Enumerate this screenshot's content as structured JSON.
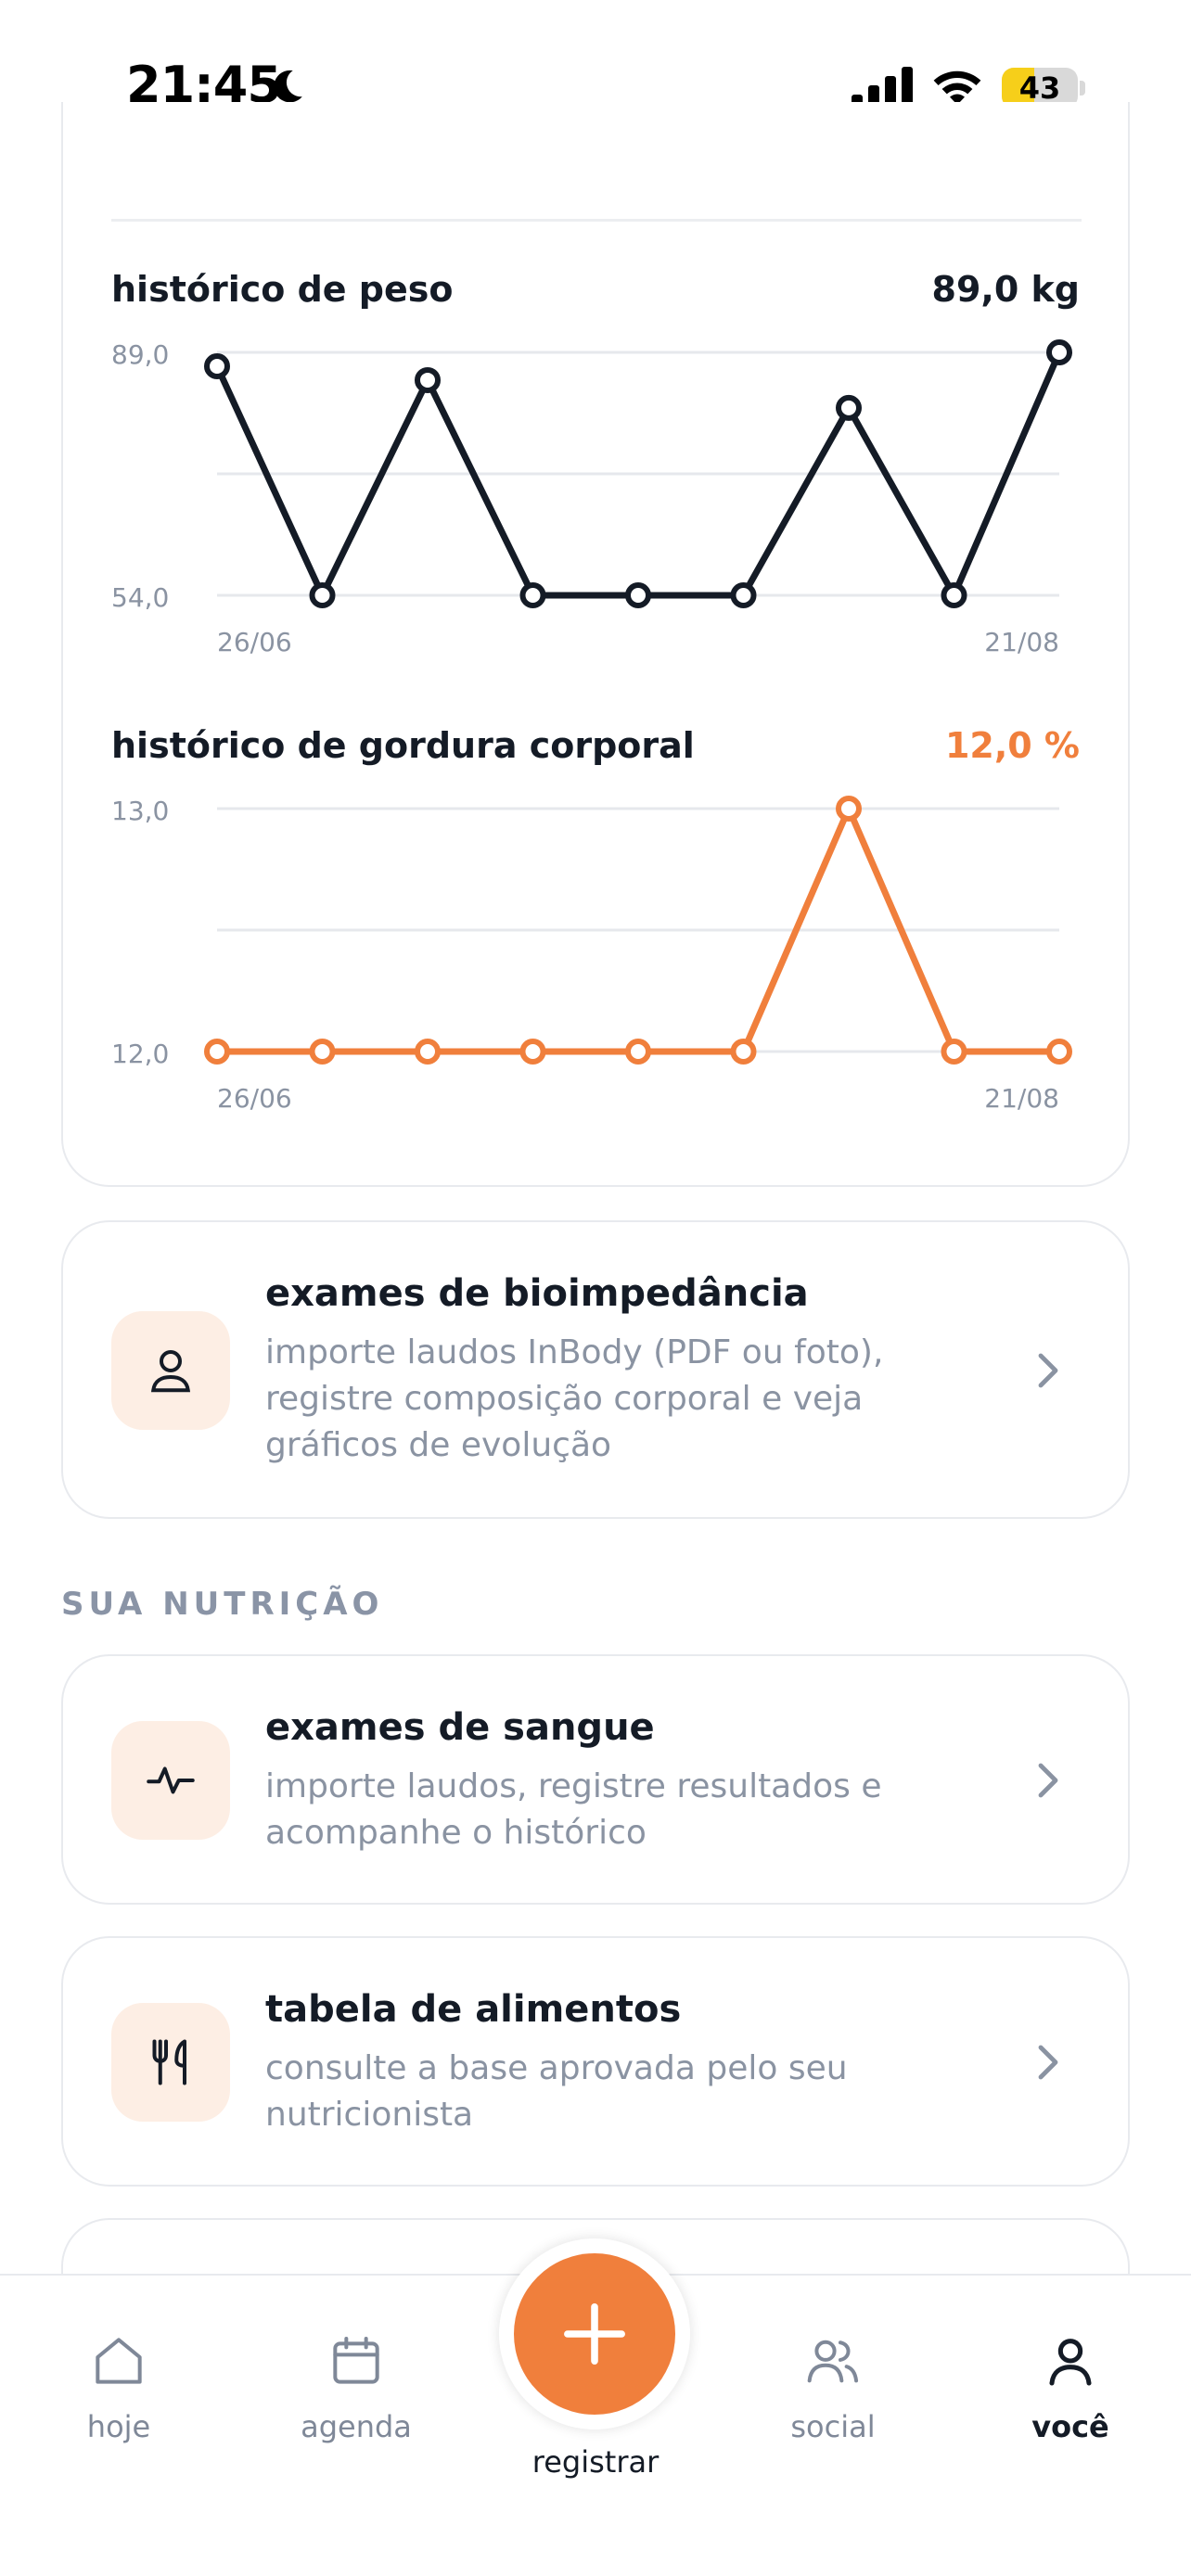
{
  "status_bar": {
    "time": "21:45",
    "battery": "43",
    "battery_level": 0.43,
    "icons": [
      "moon-icon",
      "signal-icon",
      "wifi-icon",
      "battery-icon"
    ]
  },
  "weight_chart": {
    "title": "histórico de peso",
    "current_value": "89,0 kg",
    "y_max_label": "89,0",
    "y_min_label": "54,0",
    "x_start_label": "26/06",
    "x_end_label": "21/08",
    "color": "#141b26"
  },
  "fat_chart": {
    "title": "histórico de gordura corporal",
    "current_value": "12,0 %",
    "y_max_label": "13,0",
    "y_min_label": "12,0",
    "x_start_label": "26/06",
    "x_end_label": "21/08",
    "color": "#f07f3c"
  },
  "chart_data": [
    {
      "type": "line",
      "title": "histórico de peso",
      "x": [
        "26/06",
        "",
        "",
        "",
        "",
        "",
        "",
        "",
        "21/08"
      ],
      "series": [
        {
          "values": [
            87.0,
            54.0,
            85.0,
            54.0,
            54.0,
            54.0,
            81.0,
            54.0,
            89.0
          ]
        }
      ],
      "ylim": [
        54.0,
        89.0
      ],
      "yticks": [
        "54,0",
        "89,0"
      ],
      "grid": true,
      "color": "#141b26"
    },
    {
      "type": "line",
      "title": "histórico de gordura corporal",
      "x": [
        "26/06",
        "",
        "",
        "",
        "",
        "",
        "",
        "",
        "21/08"
      ],
      "series": [
        {
          "values": [
            12.0,
            12.0,
            12.0,
            12.0,
            12.0,
            12.0,
            13.0,
            12.0,
            12.0
          ]
        }
      ],
      "ylim": [
        12.0,
        13.0
      ],
      "yticks": [
        "12,0",
        "13,0"
      ],
      "grid": true,
      "color": "#f07f3c"
    }
  ],
  "bioimpedance": {
    "title": "exames de bioimpedância",
    "description": "importe laudos InBody (PDF ou foto), registre composição corporal e veja gráficos de evolução",
    "icon": "person-icon"
  },
  "nutrition_section": {
    "label": "SUA NUTRIÇÃO"
  },
  "blood_exams": {
    "title": "exames de sangue",
    "description": "importe laudos, registre resultados e acompanhe o histórico",
    "icon": "pulse-icon"
  },
  "food_table": {
    "title": "tabela de alimentos",
    "description": "consulte a base aprovada pelo seu nutricionista",
    "icon": "utensils-icon"
  },
  "bottom_nav": {
    "items": [
      {
        "label": "hoje",
        "icon": "home-icon"
      },
      {
        "label": "agenda",
        "icon": "calendar-icon"
      },
      {
        "label": "registrar",
        "icon": "plus-icon"
      },
      {
        "label": "social",
        "icon": "users-icon"
      },
      {
        "label": "você",
        "icon": "user-icon"
      }
    ],
    "active": "você",
    "accent": "#f07f3c"
  }
}
